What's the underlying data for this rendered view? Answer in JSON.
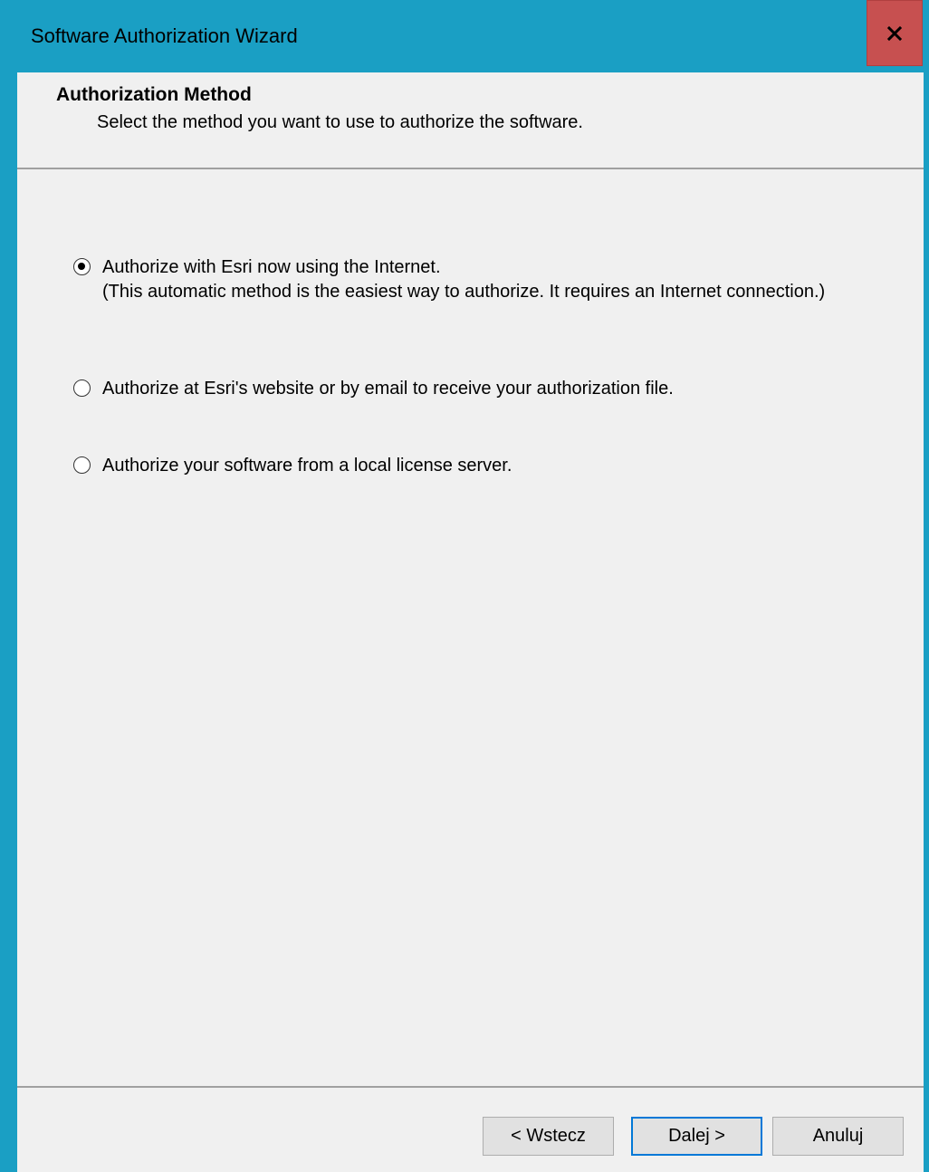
{
  "window": {
    "title": "Software Authorization Wizard",
    "close_icon": "close-icon"
  },
  "header": {
    "title": "Authorization Method",
    "subtitle": "Select the method you want to use to authorize the software."
  },
  "options": [
    {
      "line1": "Authorize with Esri now using the Internet.",
      "line2": "(This automatic method is the easiest way to authorize. It requires an Internet connection.)",
      "selected": true
    },
    {
      "line1": "Authorize at Esri's website or by email to receive your authorization file.",
      "line2": "",
      "selected": false
    },
    {
      "line1": "Authorize your software from a local license server.",
      "line2": "",
      "selected": false
    }
  ],
  "buttons": {
    "back": "< Wstecz",
    "next": "Dalej >",
    "cancel": "Anuluj"
  },
  "colors": {
    "titlebar": "#1a9fc4",
    "close": "#c75050",
    "panel": "#f0f0f0",
    "default_button_border": "#0078d7"
  }
}
